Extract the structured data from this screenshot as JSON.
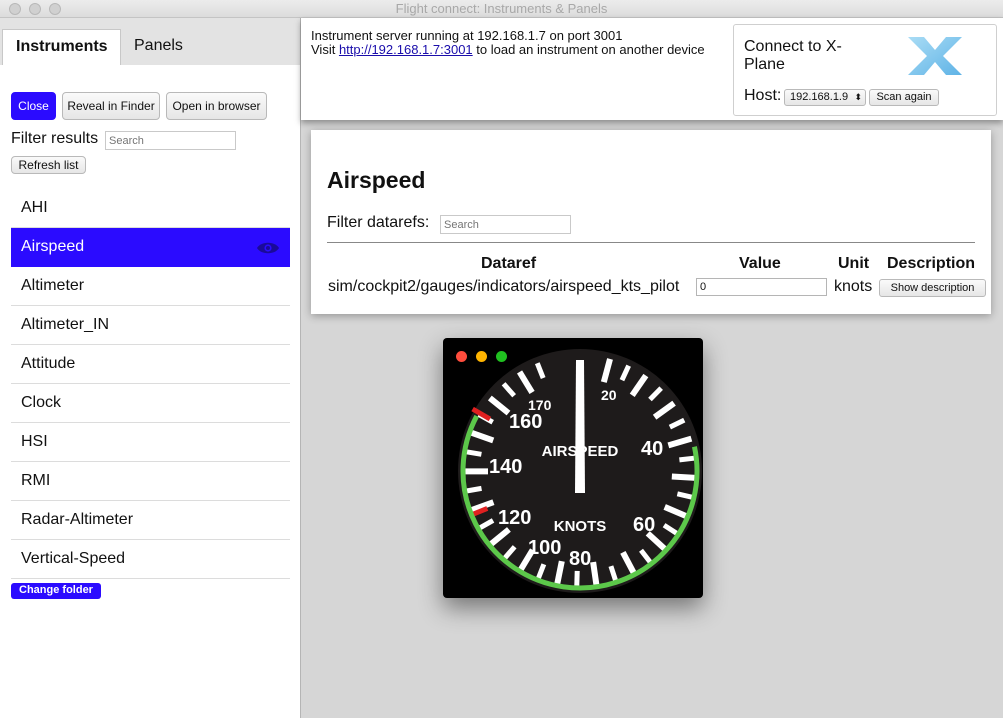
{
  "window": {
    "title": "Flight connect: Instruments & Panels"
  },
  "sidebar": {
    "tabs": [
      {
        "label": "Instruments"
      },
      {
        "label": "Panels"
      }
    ],
    "buttons": {
      "close": "Close",
      "reveal": "Reveal in Finder",
      "open_browser": "Open in browser"
    },
    "filter": {
      "label": "Filter results",
      "placeholder": "Search"
    },
    "refresh": "Refresh list",
    "items": [
      {
        "label": "AHI"
      },
      {
        "label": "Airspeed"
      },
      {
        "label": "Altimeter"
      },
      {
        "label": "Altimeter_IN"
      },
      {
        "label": "Attitude"
      },
      {
        "label": "Clock"
      },
      {
        "label": "HSI"
      },
      {
        "label": "RMI"
      },
      {
        "label": "Radar-Altimeter"
      },
      {
        "label": "Vertical-Speed"
      }
    ],
    "selected_index": 1,
    "change_folder": "Change folder"
  },
  "server": {
    "line1": "Instrument server running at 192.168.1.7 on port 3001",
    "visit_prefix": "Visit ",
    "url": "http://192.168.1.7:3001",
    "visit_suffix": " to load an instrument on another device"
  },
  "connect": {
    "title": "Connect to X-Plane",
    "host_label": "Host:",
    "host_value": "192.168.1.9",
    "scan": "Scan again"
  },
  "panel": {
    "title": "Airspeed",
    "filter_label": "Filter datarefs:",
    "filter_placeholder": "Search",
    "columns": {
      "dataref": "Dataref",
      "value": "Value",
      "unit": "Unit",
      "description": "Description"
    },
    "row": {
      "dataref": "sim/cockpit2/gauges/indicators/airspeed_kts_pilot",
      "value": "0",
      "unit": "knots",
      "button": "Show description"
    }
  },
  "gauge": {
    "title": "AIRSPEED",
    "unit": "KNOTS",
    "labels": [
      "20",
      "40",
      "60",
      "80",
      "100",
      "120",
      "140",
      "160",
      "170"
    ],
    "needle_value": 0,
    "colors": {
      "arc_green": "#5cc84a",
      "arc_red": "#e02020",
      "dot_red": "#ff4d3d",
      "dot_yellow": "#ffb400",
      "dot_green": "#20c020",
      "accent": "#2b0bff"
    }
  }
}
